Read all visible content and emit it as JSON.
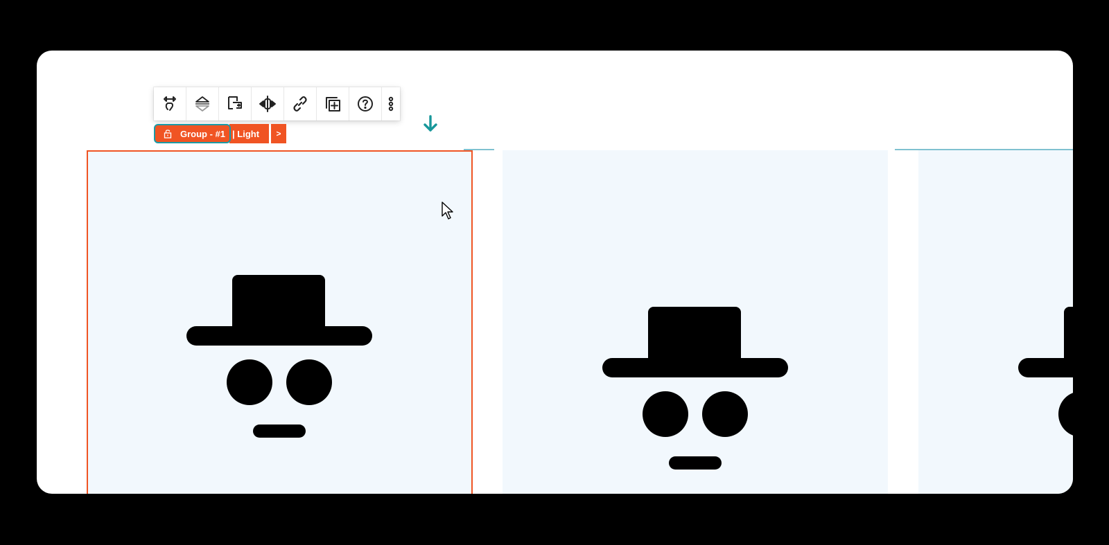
{
  "toolbar": {
    "icons": [
      "move-icon",
      "layers-icon",
      "edit-icon",
      "resize-icon",
      "link-icon",
      "duplicate-icon",
      "help-icon",
      "more-icon"
    ]
  },
  "breadcrumb": {
    "group_label": "Group - #1",
    "light_label": "| Light",
    "next_label": ">"
  },
  "colors": {
    "accent": "#f05423",
    "highlight": "#1a9aa6",
    "card_bg": "#f2f8fd",
    "guide": "#7fc1d0",
    "frame": "#000000"
  },
  "cards": [
    {
      "name": "card-1",
      "selected": true
    },
    {
      "name": "card-2",
      "selected": false
    },
    {
      "name": "card-3",
      "selected": false
    }
  ]
}
